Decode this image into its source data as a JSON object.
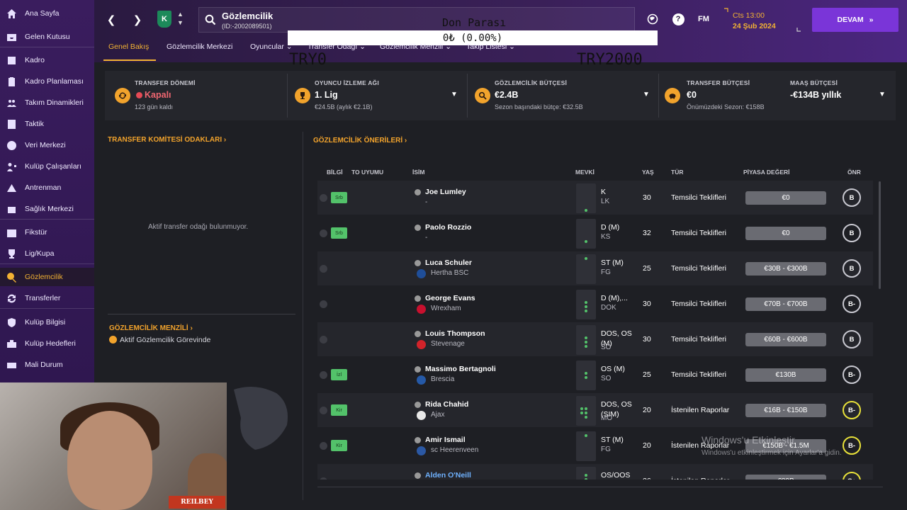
{
  "sidebar": {
    "items": [
      {
        "label": "Ana Sayfa",
        "icon": "home-icon"
      },
      {
        "label": "Gelen Kutusu",
        "icon": "inbox-icon"
      },
      {
        "label": "Kadro",
        "icon": "squad-icon"
      },
      {
        "label": "Kadro Planlaması",
        "icon": "clipboard-icon"
      },
      {
        "label": "Takım Dinamikleri",
        "icon": "people-icon"
      },
      {
        "label": "Taktik",
        "icon": "tactics-icon"
      },
      {
        "label": "Veri Merkezi",
        "icon": "data-icon"
      },
      {
        "label": "Kulüp Çalışanları",
        "icon": "staff-icon"
      },
      {
        "label": "Antrenman",
        "icon": "training-icon"
      },
      {
        "label": "Sağlık Merkezi",
        "icon": "medical-icon"
      },
      {
        "label": "Fikstür",
        "icon": "calendar-icon"
      },
      {
        "label": "Lig/Kupa",
        "icon": "trophy-icon"
      },
      {
        "label": "Gözlemcilik",
        "icon": "scouting-icon"
      },
      {
        "label": "Transferler",
        "icon": "transfer-icon"
      },
      {
        "label": "Kulüp Bilgisi",
        "icon": "shield-icon"
      },
      {
        "label": "Kulüp Hedefleri",
        "icon": "briefcase-icon"
      },
      {
        "label": "Mali Durum",
        "icon": "money-icon"
      }
    ]
  },
  "header": {
    "title": "Gözlemcilik",
    "subtitle": "(ID:-2002089501)",
    "club_initial": "K",
    "fm_label": "FM",
    "help_label": "?",
    "date_time": "Cts 13:00",
    "date": "24 Şub 2024",
    "continue_label": "DEVAM",
    "continue_icon": "double-chevron-icon"
  },
  "overlay": {
    "para_label": "Don Parası",
    "para_value": "0₺ (0.00%)",
    "range_min": "TRY0",
    "range_max": "TRY2000"
  },
  "tabs": [
    "Genel Bakış",
    "Gözlemcilik Merkezi",
    "Oyuncular",
    "Transfer Odağı",
    "Gözlemcilik Menzili",
    "Takip Listesi"
  ],
  "summary": {
    "transfer_window": {
      "title": "TRANSFER DÖNEMİ",
      "value": "Kapalı",
      "sub": "123 gün kaldı"
    },
    "scout_network": {
      "title": "OYUNCU İZLEME AĞI",
      "value": "1. Lig",
      "sub": "€24.5B (aylık €2.1B)"
    },
    "scout_budget": {
      "title": "GÖZLEMCİLİK BÜTÇESİ",
      "value": "€2.4B",
      "sub": "Sezon başındaki bütçe: €32.5B"
    },
    "transfer_budget": {
      "title": "TRANSFER BÜTÇESİ",
      "value": "€0",
      "sub": "Önümüzdeki Sezon: €158B"
    },
    "wage_budget": {
      "title": "MAAŞ BÜTÇESİ",
      "value": "-€134B yıllık"
    }
  },
  "left": {
    "focus_title": "TRANSFER KOMİTESİ ODAKLARI",
    "focus_empty": "Aktif transfer odağı bulunmuyor.",
    "range_title": "GÖZLEMCİLİK MENZİLİ",
    "mission": "Aktif Gözlemcilik Görevinde"
  },
  "table": {
    "title": "GÖZLEMCİLİK ÖNERİLERİ",
    "headers": {
      "info": "BİLGİ",
      "to": "TO UYUMU",
      "name": "İSİM",
      "pos": "MEVKİ",
      "age": "YAŞ",
      "type": "TÜR",
      "value": "PİYASA DEĞERİ",
      "rec": "ÖNR"
    },
    "rows": [
      {
        "tag": "Srb",
        "name": "Joe Lumley",
        "club": "-",
        "pos": "K",
        "pos_sub": "LK",
        "age": "30",
        "type": "Temsilci Teklifleri",
        "value": "€0",
        "rating": "B",
        "rating_color": "#c9c9d1"
      },
      {
        "tag": "Srb",
        "name": "Paolo Rozzio",
        "club": "-",
        "pos": "D (M)",
        "pos_sub": "KS",
        "age": "32",
        "type": "Temsilci Teklifleri",
        "value": "€0",
        "rating": "B",
        "rating_color": "#c9c9d1"
      },
      {
        "tag": "",
        "name": "Luca Schuler",
        "club": "Hertha BSC",
        "pos": "ST (M)",
        "pos_sub": "FG",
        "age": "25",
        "type": "Temsilci Teklifleri",
        "value": "€30B - €300B",
        "rating": "B",
        "rating_color": "#c9c9d1"
      },
      {
        "tag": "",
        "name": "George Evans",
        "club": "Wrexham",
        "pos": "D (M),...",
        "pos_sub": "DOK",
        "age": "30",
        "type": "Temsilci Teklifleri",
        "value": "€70B - €700B",
        "rating": "B-",
        "rating_color": "#c9c9d1"
      },
      {
        "tag": "",
        "name": "Louis Thompson",
        "club": "Stevenage",
        "pos": "DOS, OS (M)",
        "pos_sub": "SO",
        "age": "30",
        "type": "Temsilci Teklifleri",
        "value": "€60B - €600B",
        "rating": "B",
        "rating_color": "#c9c9d1"
      },
      {
        "tag": "İzl",
        "name": "Massimo Bertagnoli",
        "club": "Brescia",
        "pos": "OS (M)",
        "pos_sub": "SO",
        "age": "25",
        "type": "Temsilci Teklifleri",
        "value": "€130B",
        "rating": "B-",
        "rating_color": "#c9c9d1"
      },
      {
        "tag": "Kir",
        "name": "Rida Chahid",
        "club": "Ajax",
        "pos": "DOS, OS (SIM)",
        "pos_sub": "MO",
        "age": "20",
        "type": "İstenilen Raporlar",
        "value": "€16B - €150B",
        "rating": "B-",
        "rating_color": "#e9e23a"
      },
      {
        "tag": "Kir",
        "name": "Amir Ismail",
        "club": "sc Heerenveen",
        "pos": "ST (M)",
        "pos_sub": "FG",
        "age": "20",
        "type": "İstenilen Raporlar",
        "value": "€150B - €1.5M",
        "rating": "B-",
        "rating_color": "#e9e23a"
      },
      {
        "tag": "",
        "name": "Alden O'Neill",
        "club": "",
        "pos": "OS/OOS (M)",
        "pos_sub": "",
        "age": "26",
        "type": "İstenilen Raporlar",
        "value": "€80B",
        "rating": "C+",
        "rating_color": "#e9e23a"
      }
    ]
  },
  "webcam": {
    "tag": "REILBEY"
  },
  "watermark": {
    "line1": "Windows'u Etkinleştir",
    "line2": "Windows'u etkinleştirmek için Ayarlar'a gidin."
  },
  "colors": {
    "accent": "#f2b233",
    "sidebar": "#3a1d5e",
    "continue": "#7a35d8",
    "rating_yellow": "#e9e23a"
  }
}
